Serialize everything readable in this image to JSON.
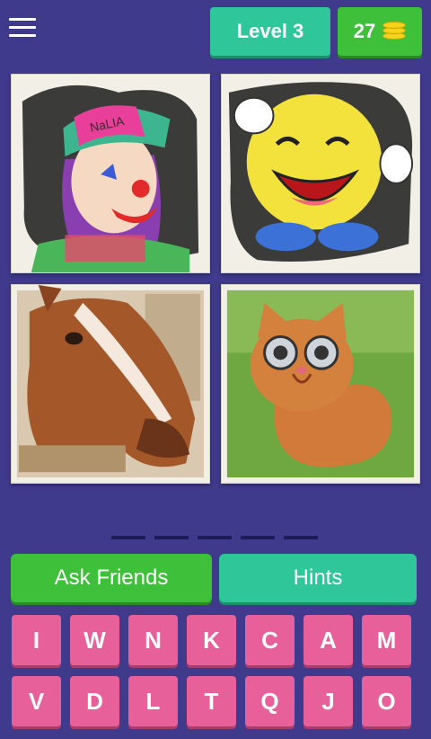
{
  "header": {
    "menu_icon": "hamburger-menu-icon",
    "level_label": "Level 3",
    "coins": "27",
    "coin_icon": "coin-stack-icon",
    "colors": {
      "level_bg": "#2fc79a",
      "coins_bg": "#3fc03a",
      "page_bg": "#3f3a8c"
    }
  },
  "puzzle": {
    "images": [
      {
        "subject": "clown painting"
      },
      {
        "subject": "laughing emoji painting"
      },
      {
        "subject": "horse painting"
      },
      {
        "subject": "cat figurine painting"
      }
    ],
    "answer_slots": 5
  },
  "actions": {
    "ask_friends_label": "Ask Friends",
    "hints_label": "Hints"
  },
  "keyboard": {
    "row1": [
      "I",
      "W",
      "N",
      "K",
      "C",
      "A",
      "M"
    ],
    "row2": [
      "V",
      "D",
      "L",
      "T",
      "Q",
      "J",
      "O"
    ],
    "key_color": "#e8609a"
  }
}
